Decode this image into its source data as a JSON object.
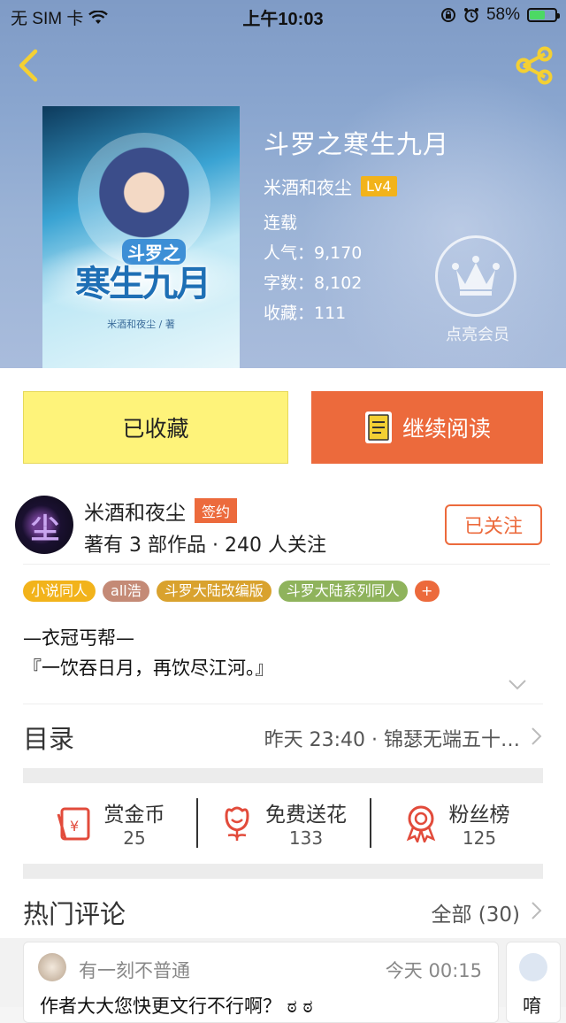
{
  "status_bar": {
    "carrier": "无 SIM 卡",
    "time": "上午10:03",
    "battery": "58%"
  },
  "book": {
    "title": "斗罗之寒生九月",
    "author": "米酒和夜尘",
    "level": "Lv4",
    "status": "连载",
    "popularity": "人气：9,170",
    "word_count": "字数：8,102",
    "favorites": "收藏：111",
    "cover": {
      "title": "寒生九月",
      "subtitle": "斗罗之",
      "author": "米酒和夜尘 / 著"
    }
  },
  "vip": {
    "label": "点亮会员"
  },
  "actions": {
    "collected": "已收藏",
    "continue_reading": "继续阅读"
  },
  "author": {
    "name": "米酒和夜尘",
    "badge": "签约",
    "stats": "著有 3 部作品 · 240 人关注",
    "follow": "已关注",
    "avatar_glyph": "尘"
  },
  "tags": [
    {
      "label": "小说同人",
      "color": "#f2b31b"
    },
    {
      "label": "all浩",
      "color": "#c48a76"
    },
    {
      "label": "斗罗大陆改编版",
      "color": "#d9a22e"
    },
    {
      "label": "斗罗大陆系列同人",
      "color": "#8fb35c"
    },
    {
      "label": "+",
      "color": "#ec6a3c"
    }
  ],
  "intro": {
    "line1": "—衣冠丐帮—",
    "line2": "『一饮吞日月，再饮尽江河。』"
  },
  "toc": {
    "title": "目录",
    "latest": "昨天 23:40 · 锦瑟无端五十…"
  },
  "rewards": [
    {
      "label": "赏金币",
      "count": "25"
    },
    {
      "label": "免费送花",
      "count": "133"
    },
    {
      "label": "粉丝榜",
      "count": "125"
    }
  ],
  "hot_comments": {
    "title": "热门评论",
    "all": "全部 (30)",
    "items": [
      {
        "user": "有一刻不普通",
        "time": "今天 00:15",
        "text": "作者大大您快更文行不行啊？ ಠ ಠ"
      },
      {
        "text": "唷"
      }
    ]
  },
  "colors": {
    "accent": "#ec6a3c",
    "collected_bg": "#fef37a",
    "level_badge": "#f2b31b"
  }
}
